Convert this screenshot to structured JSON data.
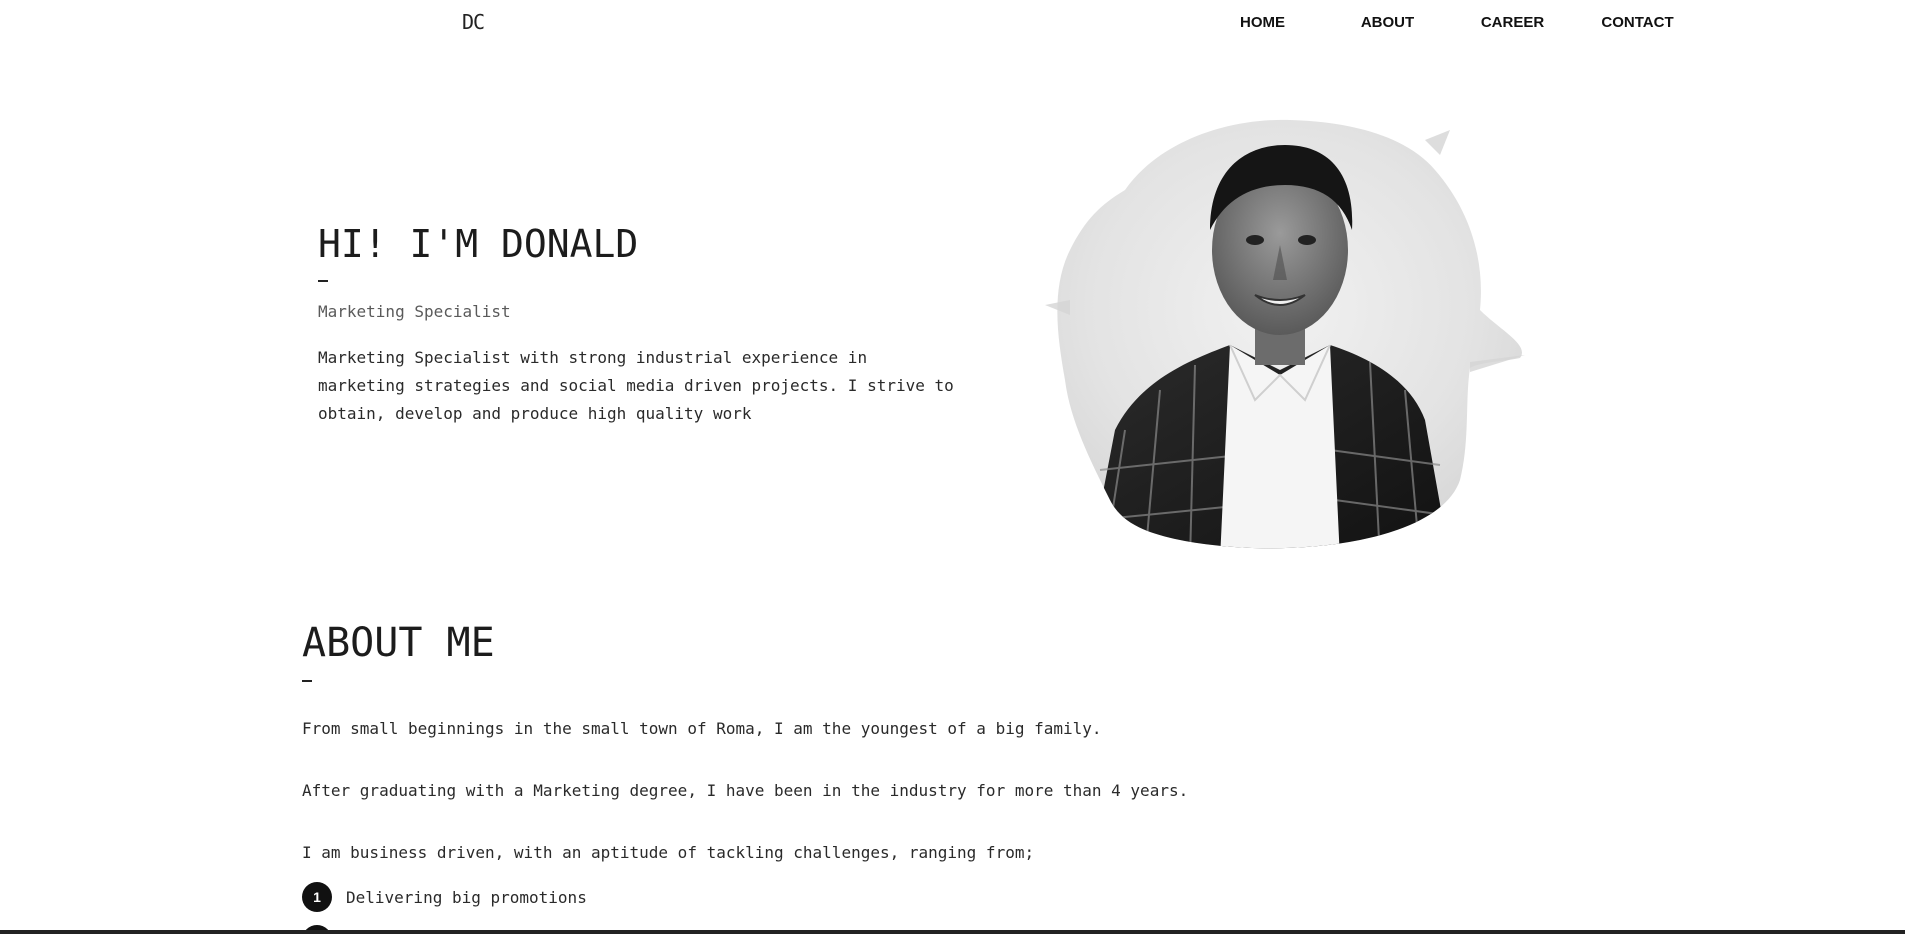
{
  "nav": {
    "logo": "DC",
    "links": [
      "HOME",
      "ABOUT",
      "CAREER",
      "CONTACT"
    ]
  },
  "hero": {
    "title": "HI! I'M DONALD",
    "role": "Marketing Specialist",
    "description": "Marketing Specialist with strong industrial experience in marketing strategies and social media driven projects. I strive to obtain, develop and produce high quality work"
  },
  "about": {
    "title": "ABOUT ME",
    "paragraphs": [
      "From small beginnings in the small town of Roma, I am the youngest of a big family.",
      "After graduating with a Marketing degree, I have been in the industry for more than 4 years.",
      "I am business driven, with an aptitude of tackling challenges, ranging from;"
    ],
    "list": [
      {
        "number": "1",
        "text": "Delivering big promotions"
      }
    ]
  }
}
